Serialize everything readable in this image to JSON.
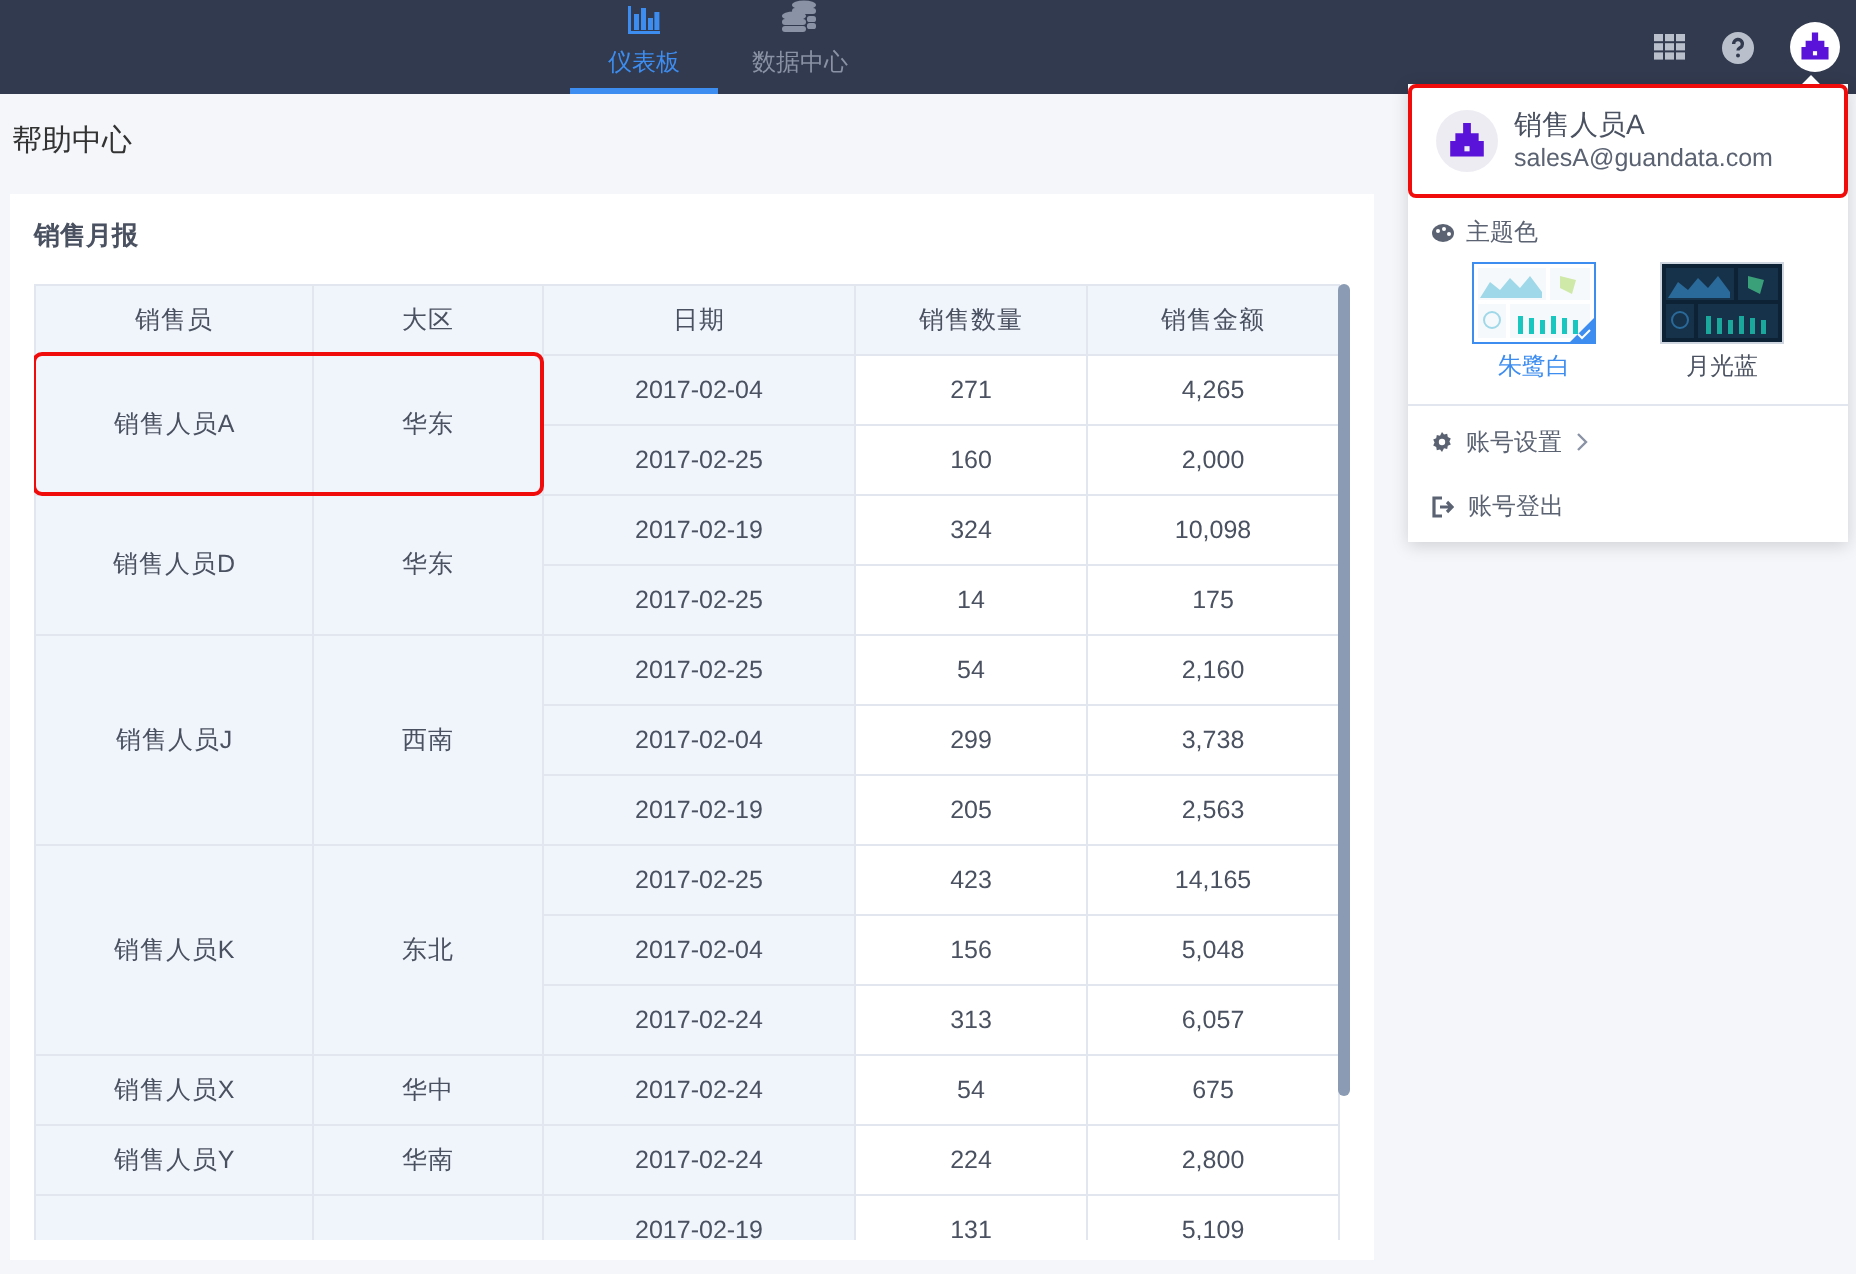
{
  "nav_tabs": [
    {
      "label": "仪表板",
      "selected": true
    },
    {
      "label": "数据中心",
      "selected": false
    }
  ],
  "page_title": "帮助中心",
  "card": {
    "title": "销售月报",
    "table": {
      "columns": [
        "销售员",
        "大区",
        "日期",
        "销售数量",
        "销售金额"
      ],
      "groups": [
        {
          "salesperson": "销售人员A",
          "region": "华东",
          "highlighted": true,
          "records": [
            {
              "date": "2017-02-04",
              "qty": "271",
              "amount": "4,265"
            },
            {
              "date": "2017-02-25",
              "qty": "160",
              "amount": "2,000"
            }
          ]
        },
        {
          "salesperson": "销售人员D",
          "region": "华东",
          "highlighted": false,
          "records": [
            {
              "date": "2017-02-19",
              "qty": "324",
              "amount": "10,098"
            },
            {
              "date": "2017-02-25",
              "qty": "14",
              "amount": "175"
            }
          ]
        },
        {
          "salesperson": "销售人员J",
          "region": "西南",
          "highlighted": false,
          "records": [
            {
              "date": "2017-02-25",
              "qty": "54",
              "amount": "2,160"
            },
            {
              "date": "2017-02-04",
              "qty": "299",
              "amount": "3,738"
            },
            {
              "date": "2017-02-19",
              "qty": "205",
              "amount": "2,563"
            }
          ]
        },
        {
          "salesperson": "销售人员K",
          "region": "东北",
          "highlighted": false,
          "records": [
            {
              "date": "2017-02-25",
              "qty": "423",
              "amount": "14,165"
            },
            {
              "date": "2017-02-04",
              "qty": "156",
              "amount": "5,048"
            },
            {
              "date": "2017-02-24",
              "qty": "313",
              "amount": "6,057"
            }
          ]
        },
        {
          "salesperson": "销售人员X",
          "region": "华中",
          "highlighted": false,
          "records": [
            {
              "date": "2017-02-24",
              "qty": "54",
              "amount": "675"
            }
          ]
        },
        {
          "salesperson": "销售人员Y",
          "region": "华南",
          "highlighted": false,
          "records": [
            {
              "date": "2017-02-24",
              "qty": "224",
              "amount": "2,800"
            }
          ]
        },
        {
          "records": [
            {
              "date": "2017-02-19",
              "qty": "131",
              "amount": "5,109"
            }
          ]
        }
      ]
    }
  },
  "user_menu": {
    "name": "销售人员A",
    "email": "salesA@guandata.com",
    "highlighted": true,
    "theme_label": "主题色",
    "themes": [
      {
        "label": "朱鹭白",
        "kind": "light",
        "selected": true
      },
      {
        "label": "月光蓝",
        "kind": "dark",
        "selected": false
      }
    ],
    "items": [
      {
        "label": "账号设置",
        "has_submenu": true
      },
      {
        "label": "账号登出",
        "has_submenu": false
      }
    ]
  }
}
